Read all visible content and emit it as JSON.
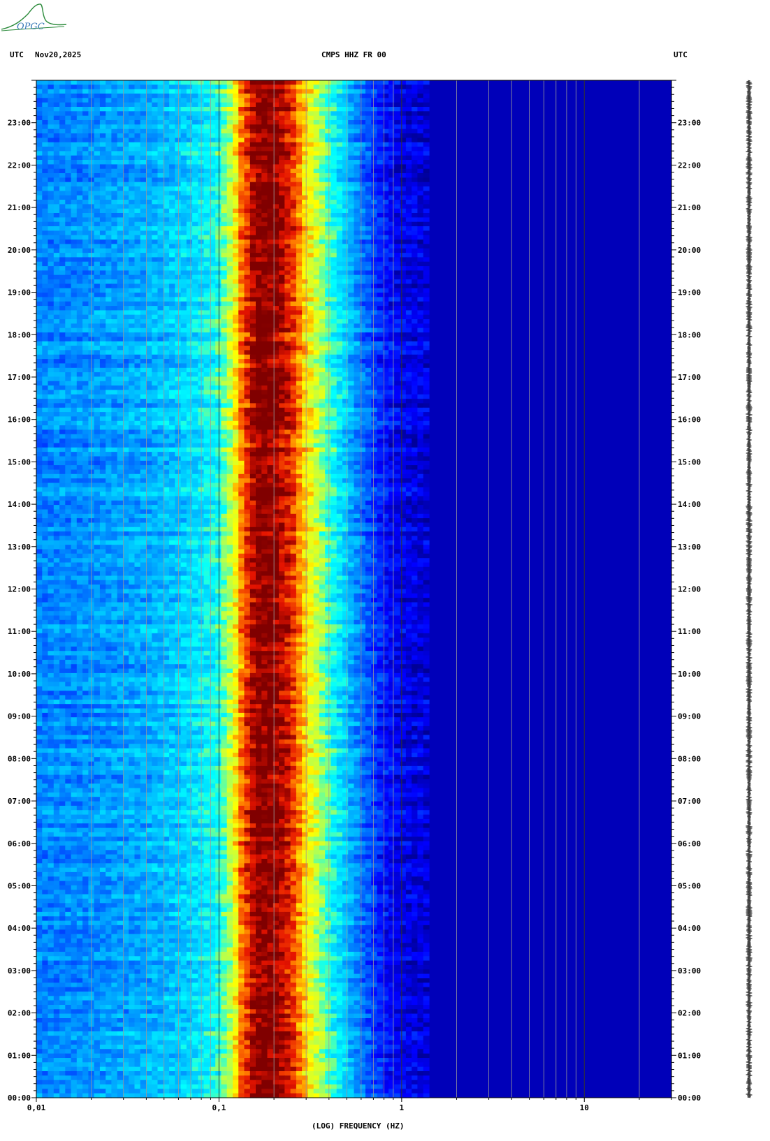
{
  "logo": {
    "text": "OPGC",
    "color": "#2a8a3a"
  },
  "header": {
    "left_tz": "UTC",
    "date": "Nov20,2025",
    "station": "CMPS HHZ FR 00",
    "right_tz": "UTC"
  },
  "colors": {
    "low": "#0000a0",
    "mid": "#00c8ff",
    "high": "#ffff00",
    "peak": "#800000"
  },
  "chart_data": {
    "type": "heatmap",
    "title": "CMPS HHZ FR 00",
    "xlabel": "(LOG) FREQUENCY (HZ)",
    "ylabel": "",
    "x_scale": "log",
    "xlim": [
      0.01,
      30
    ],
    "ylim_hours": [
      0,
      24
    ],
    "x_ticks": [
      {
        "value": 0.01,
        "label": "0,01"
      },
      {
        "value": 0.1,
        "label": "0,1"
      },
      {
        "value": 1,
        "label": "1"
      },
      {
        "value": 10,
        "label": "10"
      }
    ],
    "y_ticks": [
      {
        "hour": 0,
        "label": "00:00"
      },
      {
        "hour": 1,
        "label": "01:00"
      },
      {
        "hour": 2,
        "label": "02:00"
      },
      {
        "hour": 3,
        "label": "03:00"
      },
      {
        "hour": 4,
        "label": "04:00"
      },
      {
        "hour": 5,
        "label": "05:00"
      },
      {
        "hour": 6,
        "label": "06:00"
      },
      {
        "hour": 7,
        "label": "07:00"
      },
      {
        "hour": 8,
        "label": "08:00"
      },
      {
        "hour": 9,
        "label": "09:00"
      },
      {
        "hour": 10,
        "label": "10:00"
      },
      {
        "hour": 11,
        "label": "11:00"
      },
      {
        "hour": 12,
        "label": "12:00"
      },
      {
        "hour": 13,
        "label": "13:00"
      },
      {
        "hour": 14,
        "label": "14:00"
      },
      {
        "hour": 15,
        "label": "15:00"
      },
      {
        "hour": 16,
        "label": "16:00"
      },
      {
        "hour": 17,
        "label": "17:00"
      },
      {
        "hour": 18,
        "label": "18:00"
      },
      {
        "hour": 19,
        "label": "19:00"
      },
      {
        "hour": 20,
        "label": "20:00"
      },
      {
        "hour": 21,
        "label": "21:00"
      },
      {
        "hour": 22,
        "label": "22:00"
      },
      {
        "hour": 23,
        "label": "23:00"
      }
    ],
    "spectral_profile": [
      {
        "freq": 0.01,
        "level": 0.3
      },
      {
        "freq": 0.02,
        "level": 0.32
      },
      {
        "freq": 0.04,
        "level": 0.36
      },
      {
        "freq": 0.07,
        "level": 0.42
      },
      {
        "freq": 0.1,
        "level": 0.5
      },
      {
        "freq": 0.12,
        "level": 0.65
      },
      {
        "freq": 0.13,
        "level": 0.8
      },
      {
        "freq": 0.16,
        "level": 1.0
      },
      {
        "freq": 0.2,
        "level": 1.0
      },
      {
        "freq": 0.25,
        "level": 0.9
      },
      {
        "freq": 0.3,
        "level": 0.72
      },
      {
        "freq": 0.4,
        "level": 0.52
      },
      {
        "freq": 0.5,
        "level": 0.4
      },
      {
        "freq": 0.6,
        "level": 0.28
      },
      {
        "freq": 0.8,
        "level": 0.15
      },
      {
        "freq": 1,
        "level": 0.1
      },
      {
        "freq": 2,
        "level": 0.06
      },
      {
        "freq": 5,
        "level": 0.04
      },
      {
        "freq": 30,
        "level": 0.04
      }
    ]
  }
}
